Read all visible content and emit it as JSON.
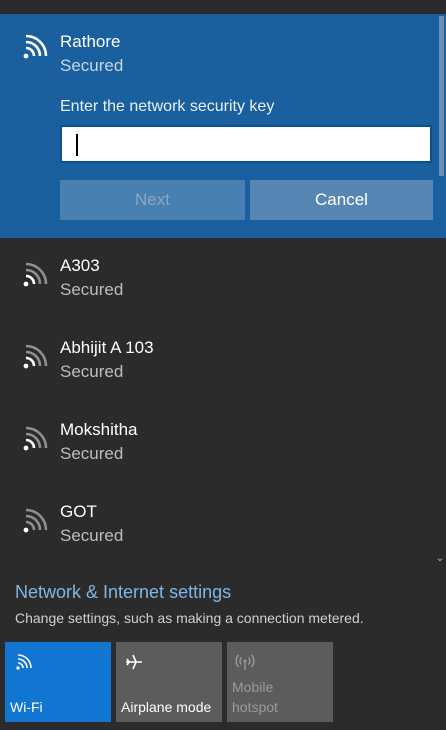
{
  "expanded_network": {
    "name": "Rathore",
    "status": "Secured",
    "key_label": "Enter the network security key",
    "key_value": "",
    "next_label": "Next",
    "cancel_label": "Cancel"
  },
  "networks": [
    {
      "name": "A303",
      "status": "Secured"
    },
    {
      "name": "Abhijit A 103",
      "status": "Secured"
    },
    {
      "name": "Mokshitha",
      "status": "Secured"
    },
    {
      "name": "GOT",
      "status": "Secured"
    }
  ],
  "settings": {
    "link": "Network & Internet settings",
    "description": "Change settings, such as making a connection metered."
  },
  "tiles": {
    "wifi": {
      "label": "Wi-Fi",
      "icon": "wifi-icon",
      "active": true
    },
    "airplane": {
      "label": "Airplane mode",
      "icon": "airplane-icon",
      "active": false
    },
    "hotspot": {
      "label_line1": "Mobile",
      "label_line2": "hotspot",
      "icon": "hotspot-icon",
      "disabled": true
    }
  },
  "colors": {
    "accent": "#1a5f9e",
    "tile_active": "#1176d1",
    "tile_inactive": "#5c5c5c",
    "link": "#7fb6e8",
    "background": "#2b2b2b"
  }
}
